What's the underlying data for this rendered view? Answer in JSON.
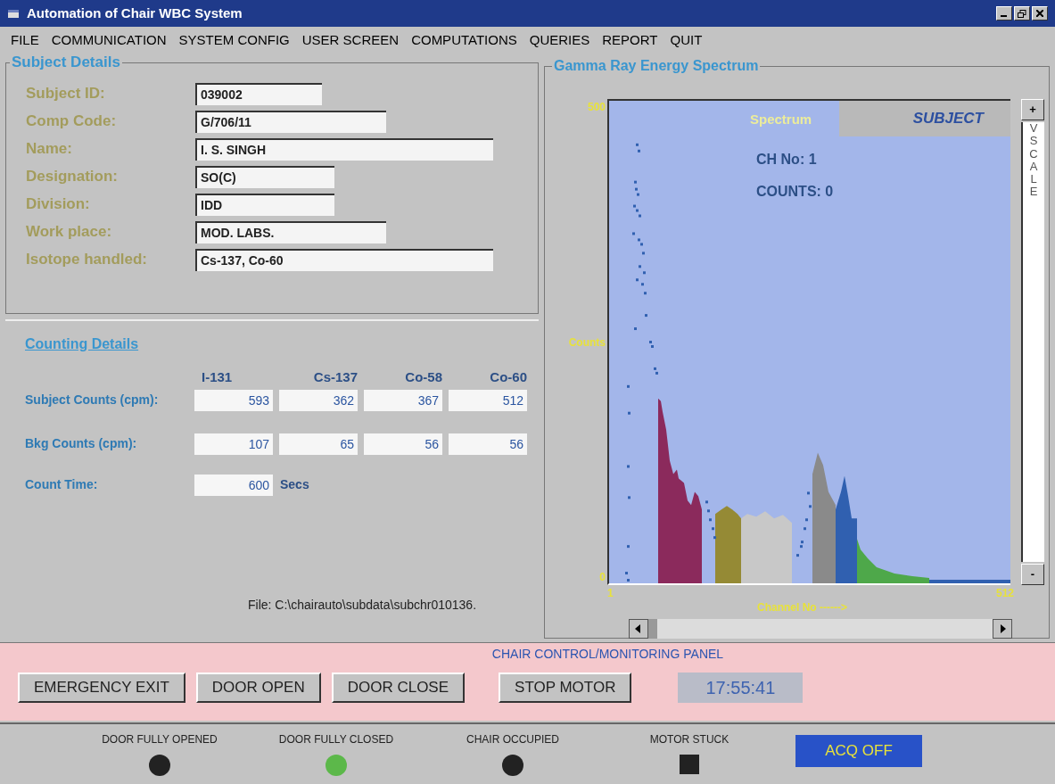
{
  "window": {
    "title": "Automation of Chair WBC System"
  },
  "menu": [
    "FILE",
    "COMMUNICATION",
    "SYSTEM CONFIG",
    "USER SCREEN",
    "COMPUTATIONS",
    "QUERIES",
    "REPORT",
    "QUIT"
  ],
  "subject_details": {
    "title": "Subject Details",
    "fields": [
      {
        "label": "Subject ID:",
        "value": "039002"
      },
      {
        "label": "Comp Code:",
        "value": "G/706/11"
      },
      {
        "label": "Name:",
        "value": "I. S. SINGH"
      },
      {
        "label": "Designation:",
        "value": "SO(C)"
      },
      {
        "label": "Division:",
        "value": "IDD"
      },
      {
        "label": "Work place:",
        "value": "MOD. LABS."
      },
      {
        "label": "Isotope handled:",
        "value": "Cs-137, Co-60"
      }
    ]
  },
  "counting_details": {
    "title": "Counting Details",
    "columns": [
      "I-131",
      "Cs-137",
      "Co-58",
      "Co-60"
    ],
    "rows": [
      {
        "label": "Subject Counts (cpm):",
        "values": [
          "593",
          "362",
          "367",
          "512"
        ]
      },
      {
        "label": "Bkg Counts (cpm):",
        "values": [
          "107",
          "65",
          "56",
          "56"
        ]
      }
    ],
    "count_time": {
      "label": "Count Time:",
      "value": "600",
      "unit": "Secs"
    },
    "file": "File:  C:\\chairauto\\subdata\\subchr010136."
  },
  "spectrum": {
    "title": "Gamma Ray Energy Spectrum",
    "legend_label": "Spectrum",
    "legend_value": "SUBJECT",
    "channel": "CH No: 1",
    "counts": "COUNTS: 0",
    "y_max": "500",
    "ylabel": "Counts",
    "y_min": "0",
    "x_min": "1",
    "x_max": "512",
    "xlabel": "Channel No ------>",
    "vscale": {
      "plus": "+",
      "label": "VSCALE",
      "minus": "-"
    }
  },
  "control_panel": {
    "title": "CHAIR CONTROL/MONITORING PANEL",
    "buttons": [
      "EMERGENCY EXIT",
      "DOOR OPEN",
      "DOOR CLOSE",
      "STOP MOTOR"
    ],
    "clock": "17:55:41"
  },
  "indicators": [
    {
      "label": "DOOR FULLY OPENED",
      "kind": "circle",
      "color": "#222222"
    },
    {
      "label": "DOOR FULLY CLOSED",
      "kind": "circle",
      "color": "#5cb84a"
    },
    {
      "label": "CHAIR OCCUPIED",
      "kind": "circle",
      "color": "#222222"
    },
    {
      "label": "MOTOR STUCK",
      "kind": "square",
      "color": "#222222"
    }
  ],
  "acquisition": "ACQ OFF"
}
